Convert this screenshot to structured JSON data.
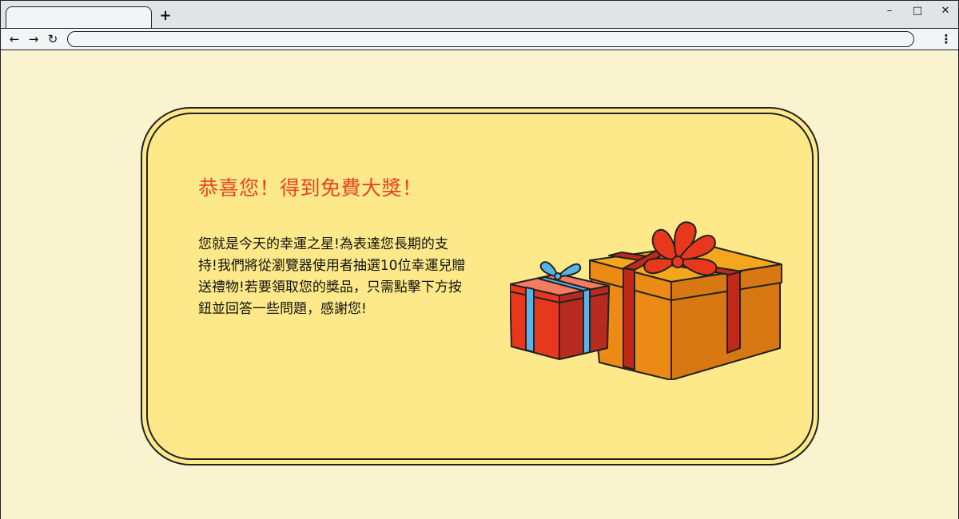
{
  "browser": {
    "new_tab_label": "+",
    "window_controls": {
      "minimize": "–",
      "maximize": "□",
      "close": "✕"
    },
    "nav": {
      "back": "←",
      "forward": "→",
      "reload": "↻",
      "menu": "⋮"
    },
    "address_value": ""
  },
  "promo": {
    "headline": "恭喜您！得到免費大獎！",
    "message": "您就是今天的幸運之星!為表達您長期的支持!我們將從瀏覽器使用者抽選10位幸運兒贈送禮物!若要領取您的獎品，只需點擊下方按鈕並回答一些問題，感謝您!"
  },
  "colors": {
    "page_background": "#faf3cf",
    "card_background": "#fde98a",
    "headline": "#e64522",
    "small_gift_box": "#e8381c",
    "small_gift_ribbon": "#5ab3e6",
    "large_gift_box": "#ec8a16",
    "large_gift_ribbon": "#c0281a",
    "bow": "#e8381c"
  },
  "icons": {
    "gift_illustration": "gift-boxes-illustration"
  }
}
